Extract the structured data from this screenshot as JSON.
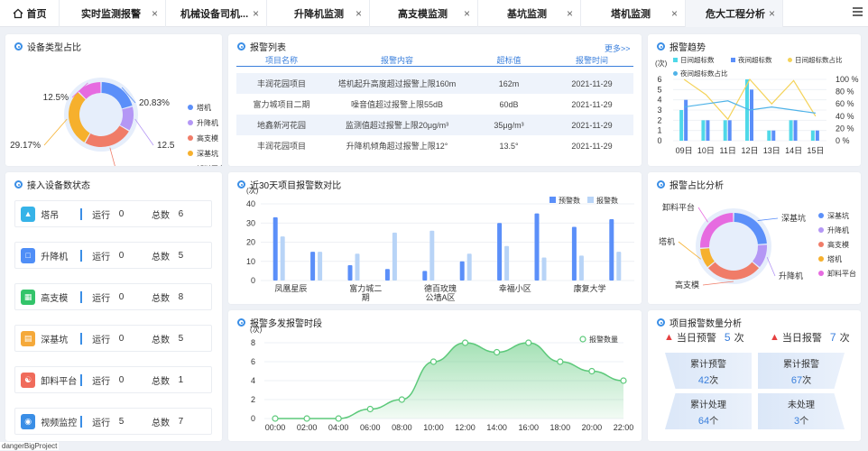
{
  "tabs": [
    {
      "label": "首页",
      "icon": "home-icon",
      "closable": false
    },
    {
      "label": "实时监测报警",
      "closable": true
    },
    {
      "label": "机械设备司机...",
      "closable": true
    },
    {
      "label": "升降机监测",
      "closable": true
    },
    {
      "label": "高支模监测",
      "closable": true
    },
    {
      "label": "基坑监测",
      "closable": true
    },
    {
      "label": "塔机监测",
      "closable": true
    },
    {
      "label": "危大工程分析",
      "closable": true,
      "active": true
    }
  ],
  "device_share": {
    "title": "设备类型占比",
    "chart_data": {
      "type": "pie",
      "labels": [
        "塔机",
        "升降机",
        "高支模",
        "深基坑",
        "卸料平台"
      ],
      "values": [
        20.83,
        12.5,
        25,
        29.17,
        12.5
      ],
      "value_labels": [
        "20.83%",
        "12.5",
        "25%",
        "29.17%",
        "12.5%"
      ],
      "colors": [
        "#5b8ff9",
        "#b497f5",
        "#f07c68",
        "#f6b02d",
        "#e66be0"
      ]
    }
  },
  "alarm_list": {
    "title": "报警列表",
    "more": "更多>>",
    "headers": [
      "项目名称",
      "报警内容",
      "超标值",
      "报警时间"
    ],
    "rows": [
      [
        "丰润花园项目",
        "塔机起升高度超过报警上限160m",
        "162m",
        "2021-11-29"
      ],
      [
        "富力城项目二期",
        "噪音值超过报警上限55dB",
        "60dB",
        "2021-11-29"
      ],
      [
        "地鑫新河花园",
        "监测值超过报警上限20μg/m³",
        "35μg/m³",
        "2021-11-29"
      ],
      [
        "丰润花园项目",
        "升降机倾角超过报警上限12°",
        "13.5°",
        "2021-11-29"
      ]
    ]
  },
  "alarm_trend": {
    "title": "报警趋势",
    "chart_data": {
      "type": "bar",
      "categories": [
        "09日",
        "10日",
        "11日",
        "12日",
        "13日",
        "14日",
        "15日"
      ],
      "ylabel_left": "(次)",
      "ylim_left": [
        0,
        6
      ],
      "left_ticks": [
        "0",
        "1",
        "2",
        "3",
        "4",
        "5",
        "6"
      ],
      "right_ticks": [
        "0 %",
        "20 %",
        "40 %",
        "60 %",
        "80 %",
        "100 %"
      ],
      "ylim_right": [
        0,
        100
      ],
      "series": [
        {
          "name": "日间超标数",
          "type": "bar",
          "color": "#4fd8e8",
          "values": [
            3,
            2,
            2,
            6,
            1,
            2,
            1
          ]
        },
        {
          "name": "夜间超标数",
          "type": "bar",
          "color": "#5b8ff9",
          "values": [
            4,
            2,
            2,
            5,
            1,
            2,
            1
          ]
        },
        {
          "name": "日间超标数占比",
          "type": "line",
          "color": "#f4d35a",
          "values": [
            100,
            75,
            35,
            100,
            60,
            98,
            40
          ]
        },
        {
          "name": "夜间超标数占比",
          "type": "line",
          "color": "#4fb3e8",
          "values": [
            55,
            60,
            65,
            50,
            55,
            50,
            45
          ]
        }
      ]
    }
  },
  "device_status": {
    "title": "接入设备数状态",
    "run_label": "运行",
    "total_label": "总数",
    "items": [
      {
        "name": "塔吊",
        "icon": "tower-crane-icon",
        "color": "#36b3e8",
        "run": "0",
        "total": "6"
      },
      {
        "name": "升降机",
        "icon": "elevator-icon",
        "color": "#4f8ef7",
        "run": "0",
        "total": "5"
      },
      {
        "name": "高支模",
        "icon": "formwork-icon",
        "color": "#33c46a",
        "run": "0",
        "total": "8"
      },
      {
        "name": "深基坑",
        "icon": "foundation-pit-icon",
        "color": "#f5a93a",
        "run": "0",
        "total": "5"
      },
      {
        "name": "卸料平台",
        "icon": "platform-icon",
        "color": "#f06b5b",
        "run": "0",
        "total": "1"
      },
      {
        "name": "视频监控",
        "icon": "camera-icon",
        "color": "#3a8ee6",
        "run": "5",
        "total": "7"
      }
    ]
  },
  "project_compare": {
    "title": "近30天项目报警数对比",
    "chart_data": {
      "type": "bar",
      "ylabel": "(次)",
      "ylim": [
        0,
        40
      ],
      "yticks": [
        "0",
        "10",
        "20",
        "30",
        "40"
      ],
      "category_labels": [
        {
          "line1": "凤凰星辰",
          "line2": ""
        },
        {
          "line1": "富力城二",
          "line2": "期"
        },
        {
          "line1": "德百玫瑰",
          "line2": "公墙A区"
        },
        {
          "line1": "幸福小区",
          "line2": ""
        },
        {
          "line1": "康复大学",
          "line2": ""
        }
      ],
      "series": [
        {
          "name": "预警数",
          "color": "#5b8ff9",
          "values": [
            33,
            15,
            8,
            6,
            5,
            10,
            30,
            35,
            28,
            32
          ]
        },
        {
          "name": "报警数",
          "color": "#b8d4f7",
          "values": [
            23,
            15,
            14,
            25,
            26,
            14,
            18,
            12,
            13,
            15
          ]
        }
      ]
    }
  },
  "time_period": {
    "title": "报警多发报警时段",
    "chart_data": {
      "type": "area",
      "ylabel": "(次)",
      "ylim": [
        0,
        8
      ],
      "yticks": [
        "0",
        "2",
        "4",
        "6",
        "8"
      ],
      "x": [
        "00:00",
        "02:00",
        "04:00",
        "06:00",
        "08:00",
        "10:00",
        "12:00",
        "14:00",
        "16:00",
        "18:00",
        "20:00",
        "22:00"
      ],
      "series": [
        {
          "name": "报警数量",
          "color": "#5cc97a",
          "values": [
            0,
            0,
            0,
            1,
            2,
            6,
            8,
            7,
            8,
            6,
            5,
            4
          ]
        }
      ]
    }
  },
  "alarm_share": {
    "title": "报警占比分析",
    "chart_data": {
      "type": "pie",
      "labels": [
        "深基坑",
        "升降机",
        "高支模",
        "塔机",
        "卸料平台"
      ],
      "values": [
        24,
        12,
        28,
        10,
        26
      ],
      "colors": [
        "#5b8ff9",
        "#b497f5",
        "#f07c68",
        "#f6b02d",
        "#e66be0"
      ]
    }
  },
  "project_count": {
    "title": "项目报警数量分析",
    "today_warn_label": "当日预警",
    "today_warn": "5",
    "today_alarm_label": "当日报警",
    "today_alarm": "7",
    "unit": "次",
    "tiles": [
      {
        "label": "累计预警",
        "value": "42",
        "unit": "次"
      },
      {
        "label": "累计报警",
        "value": "67",
        "unit": "次"
      },
      {
        "label": "累计处理",
        "value": "64",
        "unit": "个"
      },
      {
        "label": "未处理",
        "value": "3",
        "unit": "个"
      }
    ]
  },
  "footer": "dangerBigProject"
}
